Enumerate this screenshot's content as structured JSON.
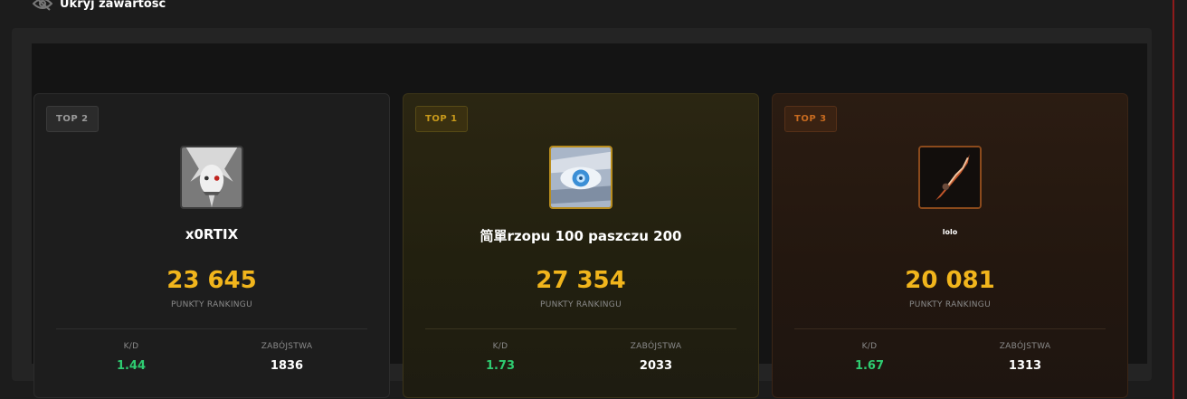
{
  "header": {
    "title": "Ukryj zawartość"
  },
  "labels": {
    "points": "PUNKTY RANKINGU",
    "kd": "K/D",
    "kills": "ZABÓJSTWA"
  },
  "cards": [
    {
      "rank": "TOP 2",
      "name": "x0RTIX",
      "points": "23 645",
      "kd": "1.44",
      "kills": "1836"
    },
    {
      "rank": "TOP 1",
      "name": "简單rzopu 100 paszczu 200",
      "points": "27 354",
      "kd": "1.73",
      "kills": "2033"
    },
    {
      "rank": "TOP 3",
      "name": "lolo",
      "points": "20 081",
      "kd": "1.67",
      "kills": "1313"
    }
  ],
  "colors": {
    "points": "#f1b51c",
    "kd": "#2ecc71",
    "gold": "#c99a1b",
    "bronze": "#c76a1f"
  }
}
